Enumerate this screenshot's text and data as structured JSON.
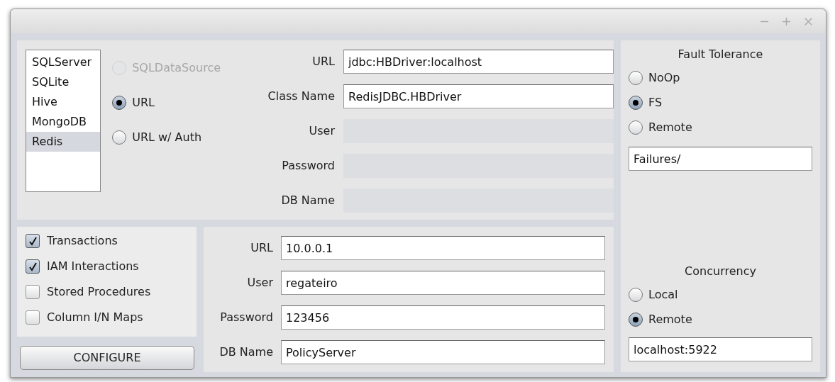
{
  "data_source": {
    "drivers": [
      {
        "label": "SQLServer",
        "selected": false
      },
      {
        "label": "SQLite",
        "selected": false
      },
      {
        "label": "Hive",
        "selected": false
      },
      {
        "label": "MongoDB",
        "selected": false
      },
      {
        "label": "Redis",
        "selected": true
      }
    ],
    "modes": [
      {
        "label": "SQLDataSource",
        "selected": false,
        "disabled": true
      },
      {
        "label": "URL",
        "selected": true,
        "disabled": false
      },
      {
        "label": "URL w/ Auth",
        "selected": false,
        "disabled": false
      }
    ],
    "fields": [
      {
        "label": "URL",
        "value": "jdbc:HBDriver:localhost",
        "disabled": false
      },
      {
        "label": "Class Name",
        "value": "RedisJDBC.HBDriver",
        "disabled": false
      },
      {
        "label": "User",
        "disabled": true
      },
      {
        "label": "Password",
        "disabled": true
      },
      {
        "label": "DB Name",
        "disabled": true
      }
    ]
  },
  "features": [
    {
      "label": "Transactions",
      "checked": true
    },
    {
      "label": "IAM Interactions",
      "checked": true
    },
    {
      "label": "Stored Procedures",
      "checked": false
    },
    {
      "label": "Column I/N Maps",
      "checked": false
    }
  ],
  "configure_button": "CONFIGURE",
  "connection": {
    "fields": [
      {
        "label": "URL",
        "value": "10.0.0.1"
      },
      {
        "label": "User",
        "value": "regateiro"
      },
      {
        "label": "Password",
        "value": "123456"
      },
      {
        "label": "DB Name",
        "value": "PolicyServer"
      }
    ]
  },
  "fault_tolerance": {
    "title": "Fault Tolerance",
    "options": [
      {
        "label": "NoOp",
        "selected": false
      },
      {
        "label": "FS",
        "selected": true
      },
      {
        "label": "Remote",
        "selected": false
      }
    ],
    "value": "Failures/"
  },
  "concurrency": {
    "title": "Concurrency",
    "options": [
      {
        "label": "Local",
        "selected": false
      },
      {
        "label": "Remote",
        "selected": true
      }
    ],
    "value": "localhost:5922"
  }
}
